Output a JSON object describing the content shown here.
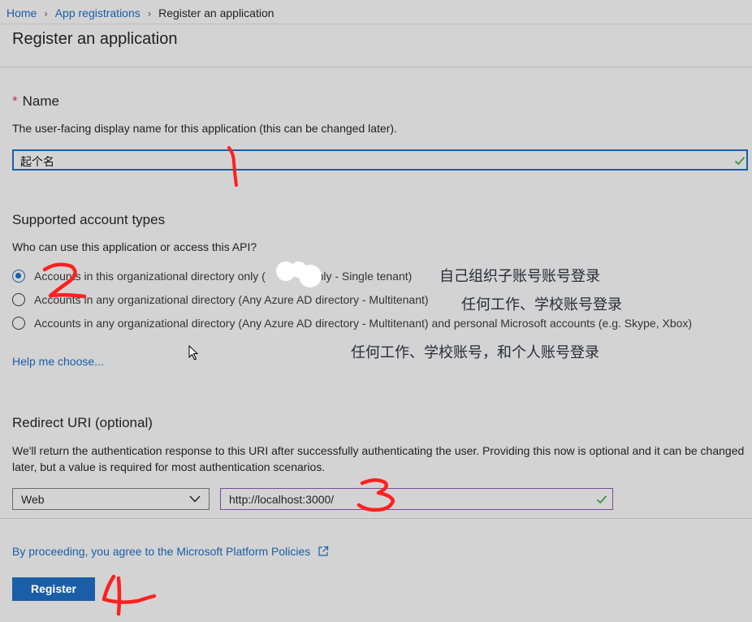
{
  "breadcrumb": {
    "home": "Home",
    "app_registrations": "App registrations",
    "current": "Register an application",
    "separator": "›"
  },
  "page_title": "Register an application",
  "name_section": {
    "required_mark": "*",
    "heading": "Name",
    "description": "The user-facing display name for this application (this can be changed later).",
    "value": "起个名"
  },
  "account_types": {
    "heading": "Supported account types",
    "question": "Who can use this application or access this API?",
    "options": [
      {
        "label": "Accounts in this organizational directory only (",
        "label_tail": "only - Single tenant)",
        "selected": true
      },
      {
        "label": "Accounts in any organizational directory (Any Azure AD directory - Multitenant)",
        "selected": false
      },
      {
        "label": "Accounts in any organizational directory (Any Azure AD directory - Multitenant) and personal Microsoft accounts (e.g. Skype, Xbox)",
        "selected": false
      }
    ],
    "help_link": "Help me choose..."
  },
  "annotations": {
    "option1_note": "自己组织子账号账号登录",
    "option2_note": "任何工作、学校账号登录",
    "option3_note": "任何工作、学校账号，和个人账号登录",
    "marks": [
      "1",
      "2",
      "3",
      "4"
    ]
  },
  "redirect": {
    "heading": "Redirect URI (optional)",
    "description": "We'll return the authentication response to this URI after successfully authenticating the user. Providing this now is optional and it can be changed later, but a value is required for most authentication scenarios.",
    "platform": "Web",
    "uri": "http://localhost:3000/"
  },
  "policy_link": "By proceeding, you agree to the Microsoft Platform Policies",
  "register_label": "Register",
  "colors": {
    "accent": "#1a5ea8",
    "valid_check": "#2e8b3a",
    "annotation_ink": "#ff2020",
    "background": "#d3d3d3"
  }
}
